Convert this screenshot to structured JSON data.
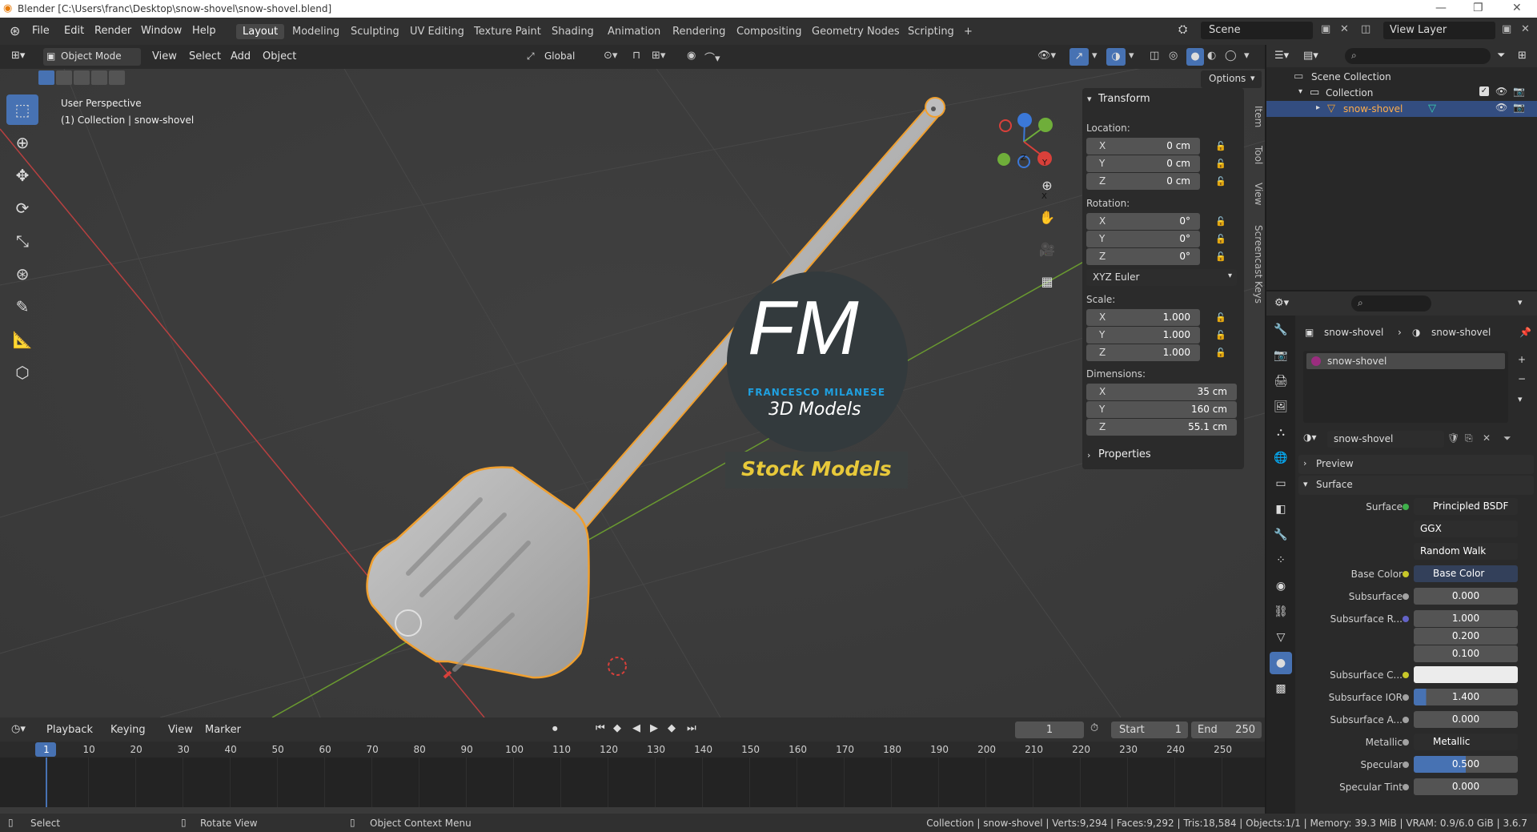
{
  "window": {
    "title": "Blender [C:\\Users\\franc\\Desktop\\snow-shovel\\snow-shovel.blend]",
    "minimize": "—",
    "restore": "❐",
    "close": "✕"
  },
  "menubar": {
    "items": [
      "File",
      "Edit",
      "Render",
      "Window",
      "Help"
    ]
  },
  "workspaces": {
    "tabs": [
      "Layout",
      "Modeling",
      "Sculpting",
      "UV Editing",
      "Texture Paint",
      "Shading",
      "Animation",
      "Rendering",
      "Compositing",
      "Geometry Nodes",
      "Scripting"
    ],
    "active": "Layout",
    "add": "+"
  },
  "scene": {
    "label": "Scene",
    "view_layer": "View Layer"
  },
  "viewport_header": {
    "mode": "Object Mode",
    "menus": [
      "View",
      "Select",
      "Add",
      "Object"
    ],
    "transform_orientation": "Global",
    "options": "Options"
  },
  "viewport": {
    "perspective_label": "User Perspective",
    "collection_label": "(1) Collection | snow-shovel",
    "watermark_letters": "FM",
    "watermark_name": "FRANCESCO MILANESE",
    "watermark_sub": "3D Models",
    "watermark_stock": "Stock Models",
    "gizmo_axes": [
      "X",
      "Y",
      "Z"
    ]
  },
  "npanel": {
    "title": "Transform",
    "location_label": "Location:",
    "location": [
      {
        "axis": "X",
        "value": "0 cm"
      },
      {
        "axis": "Y",
        "value": "0 cm"
      },
      {
        "axis": "Z",
        "value": "0 cm"
      }
    ],
    "rotation_label": "Rotation:",
    "rotation": [
      {
        "axis": "X",
        "value": "0°"
      },
      {
        "axis": "Y",
        "value": "0°"
      },
      {
        "axis": "Z",
        "value": "0°"
      }
    ],
    "rotation_mode": "XYZ Euler",
    "scale_label": "Scale:",
    "scale": [
      {
        "axis": "X",
        "value": "1.000"
      },
      {
        "axis": "Y",
        "value": "1.000"
      },
      {
        "axis": "Z",
        "value": "1.000"
      }
    ],
    "dimensions_label": "Dimensions:",
    "dimensions": [
      {
        "axis": "X",
        "value": "35 cm"
      },
      {
        "axis": "Y",
        "value": "160 cm"
      },
      {
        "axis": "Z",
        "value": "55.1 cm"
      }
    ],
    "properties": "Properties",
    "side_tabs": [
      "Item",
      "Tool",
      "View",
      "Screencast Keys"
    ]
  },
  "timeline": {
    "menus": [
      "Playback",
      "Keying",
      "View",
      "Marker"
    ],
    "current_frame": "1",
    "start_label": "Start",
    "start": "1",
    "end_label": "End",
    "end": "250",
    "ruler": [
      "1",
      "10",
      "20",
      "30",
      "40",
      "50",
      "60",
      "70",
      "80",
      "90",
      "100",
      "110",
      "120",
      "130",
      "140",
      "150",
      "160",
      "170",
      "180",
      "190",
      "200",
      "210",
      "220",
      "230",
      "240",
      "250"
    ]
  },
  "statusbar": {
    "select": "Select",
    "rotate": "Rotate View",
    "context": "Object Context Menu",
    "stats": "Collection | snow-shovel | Verts:9,294 | Faces:9,292 | Tris:18,584 | Objects:1/1 | Memory: 39.3 MiB | VRAM: 0.9/6.0 GiB | 3.6.7"
  },
  "outliner": {
    "scene_collection": "Scene Collection",
    "collection": "Collection",
    "object": "snow-shovel"
  },
  "properties": {
    "breadcrumb_object": "snow-shovel",
    "breadcrumb_material": "snow-shovel",
    "material_slot": "snow-shovel",
    "material_name": "snow-shovel",
    "preview": "Preview",
    "surface_section": "Surface",
    "rows": [
      {
        "label": "Surface",
        "value": "Principled BSDF",
        "dot": "#3fb04b"
      },
      {
        "label": "",
        "value": "GGX"
      },
      {
        "label": "",
        "value": "Random Walk"
      },
      {
        "label": "Base Color",
        "value": "Base Color",
        "dot": "#c7c729"
      },
      {
        "label": "Subsurface",
        "value": "0.000",
        "dot": "#a1a1a1"
      },
      {
        "label": "Subsurface R...",
        "value": "1.000",
        "dot": "#6363c7"
      },
      {
        "label": "",
        "value": "0.200"
      },
      {
        "label": "",
        "value": "0.100"
      },
      {
        "label": "Subsurface C...",
        "value": "",
        "dot": "#c7c729"
      },
      {
        "label": "Subsurface IOR",
        "value": "1.400",
        "dot": "#a1a1a1"
      },
      {
        "label": "Subsurface A...",
        "value": "0.000",
        "dot": "#a1a1a1"
      },
      {
        "label": "Metallic",
        "value": "Metallic",
        "dot": "#a1a1a1"
      },
      {
        "label": "Specular",
        "value": "0.500",
        "dot": "#a1a1a1"
      },
      {
        "label": "Specular Tint",
        "value": "0.000",
        "dot": "#a1a1a1"
      }
    ]
  },
  "colors": {
    "accent": "#4772b3",
    "selection_outline": "#f0a030",
    "x_axis": "#d9403a",
    "y_axis": "#6fae3a",
    "z_axis": "#3b78d8",
    "watermark_blue": "#1fa0e0",
    "watermark_yellow": "#e8c93a"
  }
}
